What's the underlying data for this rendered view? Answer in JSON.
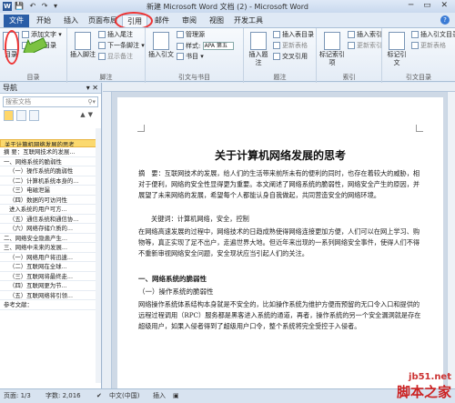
{
  "titlebar": {
    "icon_letter": "W",
    "qat": "💾 ↶ ↷ ▾",
    "title": "新建 Microsoft Word 文档 (2) - Microsoft Word",
    "controls": "─ ▭ ✕"
  },
  "tabs": [
    "文件",
    "开始",
    "插入",
    "页面布局",
    "引用",
    "邮件",
    "审阅",
    "视图",
    "开发工具"
  ],
  "active_tab": "引用",
  "ribbon": {
    "toc": {
      "big_button": "目录",
      "add_text": "添加文字 ▾",
      "update_toc": "更新目录",
      "group": "目录"
    },
    "footnotes": {
      "insert_footnote": "插入脚注",
      "insert_endnote": "插入尾注",
      "next_footnote": "下一条脚注 ▾",
      "show_notes": "显示备注",
      "group": "脚注"
    },
    "citations": {
      "insert_citation": "插入引文",
      "manage_sources": "管理源",
      "style_label": "样式:",
      "style_value": "APA 第五",
      "bibliography": "书目 ▾",
      "group": "引文与书目"
    },
    "captions": {
      "insert_caption": "插入题注",
      "insert_table_of_figures": "插入表目录",
      "update_table": "更新表格",
      "cross_reference": "交叉引用",
      "group": "题注"
    },
    "index": {
      "mark_entry": "标记索引项",
      "insert_index": "插入索引",
      "update_index": "更新索引",
      "group": "索引"
    },
    "authorities": {
      "mark_citation": "标记引文",
      "insert_table": "插入引文目录",
      "update": "更新表格",
      "group": "引文目录"
    }
  },
  "nav": {
    "title": "导航",
    "search_placeholder": "搜索文档",
    "items": [
      "关于计算机网络发展的思考",
      "摘 要：互联网技术的发展...",
      "一、网络系统的脆弱性",
      "（一）操作系统的脆弱性",
      "（二）计算机系统本身的...",
      "（三）电磁泄漏",
      "（四）数据的可访问性",
      "进入系统的用户可方...",
      "（五）通信系统和通信协...",
      "（六）网络存储介质的...",
      "二、网络安全隐患产生...",
      "三、网络中未来的发展...",
      "（一）网络用户将迅速...",
      "（二）互联网在全球...",
      "（三）互联网将最终走...",
      "（四）互联网更为节...",
      "（五）互联网络将引领...",
      "参考文献："
    ]
  },
  "document": {
    "title": "关于计算机网络发展的思考",
    "abstract": "摘　要：互联网技术的发展，给人们的生活带来前所未有的便利的同时，也存在着较大的威胁，相对于便利，网络的安全性显得更为重要。本文阐述了网络系统的脆弱性，网络安全产生的原因，并展望了未来网络的发展，希望每个人都能认身自我做起，共同营造安全的网络环境。",
    "keywords": "关键词：计算机网络，安全，控制",
    "para1": "在网络高速发展的过程中，网络技术的日趋成熟使得网络连接更加方便，人们可以在网上学习、购物等，真正实现了足不出户，走遍世界大地。但近年来出现的一系列网络安全事件，使得人们不得不重新审视网络安全问题，安全现状应当引起人们的关注。",
    "heading1": "一、网络系统的脆弱性",
    "heading2": "（一）操作系统的脆弱性",
    "para2": "网络操作系统体系结构本身就是不安全的，比如操作系统为维护方便而预留的无口令入口和提供的远程过程调用（RPC）服务都是黑客进入系统的通道，再者，操作系统的另一个安全漏洞就是存在超级用户，如果入侵者得到了超级用户口令，整个系统将完全受控于入侵者。"
  },
  "statusbar": {
    "page": "页面: 1/3",
    "words": "字数: 2,016",
    "language": "中文(中国)",
    "mode": "插入"
  },
  "watermark": {
    "url": "jb51.net",
    "text": "脚本之家"
  }
}
